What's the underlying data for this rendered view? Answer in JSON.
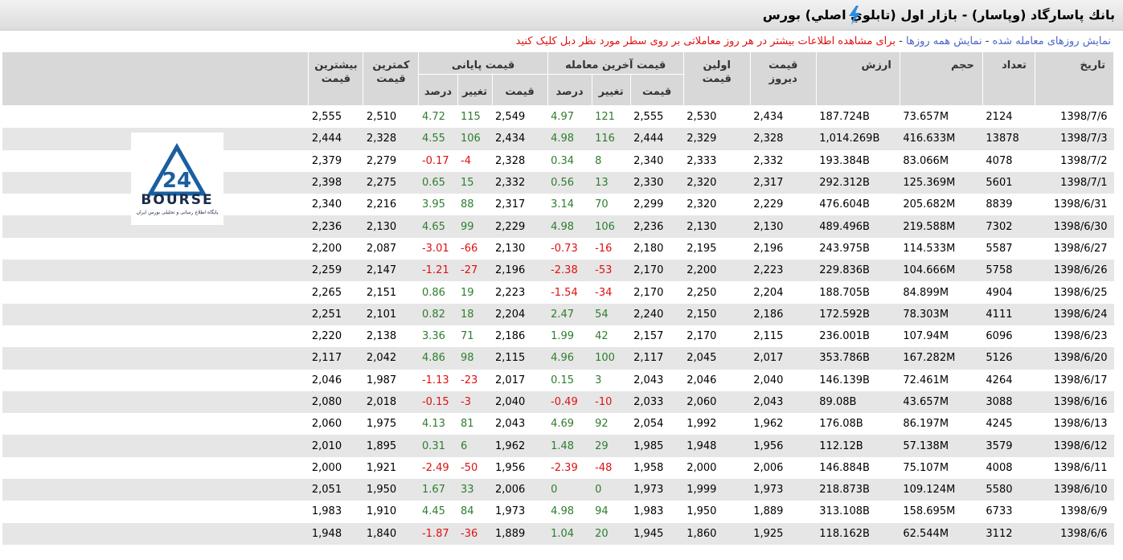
{
  "title": "بانك پاسارگاد (وپاسار) - بازار اول (تابلوي اصلي) بورس",
  "links": {
    "traded_days": "نمایش روزهای معامله شده",
    "all_days": "نمایش همه روزها",
    "separator": " - ",
    "hint": "برای مشاهده اطلاعات بیشتر در هر روز معاملاتی بر روی سطر مورد نظر دبل کلیک کنید"
  },
  "headers": {
    "date": "تاریخ",
    "count": "تعداد",
    "volume": "حجم",
    "value": "ارزش",
    "yesterday": "قیمت دیروز",
    "first": "اولین قیمت",
    "last_group": "قیمت آخرین معامله",
    "close_group": "قیمت پایانی",
    "price": "قیمت",
    "change": "تغییر",
    "percent": "درصد",
    "min": "کمترین قیمت",
    "max": "بیشترین قیمت"
  },
  "logo": {
    "word": "BOURSE",
    "number": "24",
    "tagline": "پایگاه اطلاع رسانی و تحلیلی بورس ایران"
  },
  "colors": {
    "positive": "#2e7d2e",
    "negative": "#e01010",
    "link": "#4a64c8",
    "header_bg": "#d8d8d8",
    "stripe": "#e6e6e6"
  },
  "rows": [
    {
      "date": "1398/7/6",
      "count": "2124",
      "volume": "73.657M",
      "value": "187.724B",
      "yesterday": "2,434",
      "first": "2,530",
      "last_price": "2,555",
      "last_change": "121",
      "last_percent": "4.97",
      "close_price": "2,549",
      "close_change": "115",
      "close_percent": "4.72",
      "min": "2,510",
      "max": "2,555"
    },
    {
      "date": "1398/7/3",
      "count": "13878",
      "volume": "416.633M",
      "value": "1,014.269B",
      "yesterday": "2,328",
      "first": "2,329",
      "last_price": "2,444",
      "last_change": "116",
      "last_percent": "4.98",
      "close_price": "2,434",
      "close_change": "106",
      "close_percent": "4.55",
      "min": "2,328",
      "max": "2,444"
    },
    {
      "date": "1398/7/2",
      "count": "4078",
      "volume": "83.066M",
      "value": "193.384B",
      "yesterday": "2,332",
      "first": "2,333",
      "last_price": "2,340",
      "last_change": "8",
      "last_percent": "0.34",
      "close_price": "2,328",
      "close_change": "-4",
      "close_percent": "-0.17",
      "min": "2,279",
      "max": "2,379"
    },
    {
      "date": "1398/7/1",
      "count": "5601",
      "volume": "125.369M",
      "value": "292.312B",
      "yesterday": "2,317",
      "first": "2,320",
      "last_price": "2,330",
      "last_change": "13",
      "last_percent": "0.56",
      "close_price": "2,332",
      "close_change": "15",
      "close_percent": "0.65",
      "min": "2,275",
      "max": "2,398"
    },
    {
      "date": "1398/6/31",
      "count": "8839",
      "volume": "205.682M",
      "value": "476.604B",
      "yesterday": "2,229",
      "first": "2,320",
      "last_price": "2,299",
      "last_change": "70",
      "last_percent": "3.14",
      "close_price": "2,317",
      "close_change": "88",
      "close_percent": "3.95",
      "min": "2,216",
      "max": "2,340"
    },
    {
      "date": "1398/6/30",
      "count": "7302",
      "volume": "219.588M",
      "value": "489.496B",
      "yesterday": "2,130",
      "first": "2,130",
      "last_price": "2,236",
      "last_change": "106",
      "last_percent": "4.98",
      "close_price": "2,229",
      "close_change": "99",
      "close_percent": "4.65",
      "min": "2,130",
      "max": "2,236"
    },
    {
      "date": "1398/6/27",
      "count": "5587",
      "volume": "114.533M",
      "value": "243.975B",
      "yesterday": "2,196",
      "first": "2,195",
      "last_price": "2,180",
      "last_change": "-16",
      "last_percent": "-0.73",
      "close_price": "2,130",
      "close_change": "-66",
      "close_percent": "-3.01",
      "min": "2,087",
      "max": "2,200"
    },
    {
      "date": "1398/6/26",
      "count": "5758",
      "volume": "104.666M",
      "value": "229.836B",
      "yesterday": "2,223",
      "first": "2,200",
      "last_price": "2,170",
      "last_change": "-53",
      "last_percent": "-2.38",
      "close_price": "2,196",
      "close_change": "-27",
      "close_percent": "-1.21",
      "min": "2,147",
      "max": "2,259"
    },
    {
      "date": "1398/6/25",
      "count": "4904",
      "volume": "84.899M",
      "value": "188.705B",
      "yesterday": "2,204",
      "first": "2,250",
      "last_price": "2,170",
      "last_change": "-34",
      "last_percent": "-1.54",
      "close_price": "2,223",
      "close_change": "19",
      "close_percent": "0.86",
      "min": "2,151",
      "max": "2,265"
    },
    {
      "date": "1398/6/24",
      "count": "4111",
      "volume": "78.303M",
      "value": "172.592B",
      "yesterday": "2,186",
      "first": "2,150",
      "last_price": "2,240",
      "last_change": "54",
      "last_percent": "2.47",
      "close_price": "2,204",
      "close_change": "18",
      "close_percent": "0.82",
      "min": "2,101",
      "max": "2,251"
    },
    {
      "date": "1398/6/23",
      "count": "6096",
      "volume": "107.94M",
      "value": "236.001B",
      "yesterday": "2,115",
      "first": "2,170",
      "last_price": "2,157",
      "last_change": "42",
      "last_percent": "1.99",
      "close_price": "2,186",
      "close_change": "71",
      "close_percent": "3.36",
      "min": "2,138",
      "max": "2,220"
    },
    {
      "date": "1398/6/20",
      "count": "5126",
      "volume": "167.282M",
      "value": "353.786B",
      "yesterday": "2,017",
      "first": "2,045",
      "last_price": "2,117",
      "last_change": "100",
      "last_percent": "4.96",
      "close_price": "2,115",
      "close_change": "98",
      "close_percent": "4.86",
      "min": "2,042",
      "max": "2,117"
    },
    {
      "date": "1398/6/17",
      "count": "4264",
      "volume": "72.461M",
      "value": "146.139B",
      "yesterday": "2,040",
      "first": "2,046",
      "last_price": "2,043",
      "last_change": "3",
      "last_percent": "0.15",
      "close_price": "2,017",
      "close_change": "-23",
      "close_percent": "-1.13",
      "min": "1,987",
      "max": "2,046"
    },
    {
      "date": "1398/6/16",
      "count": "3088",
      "volume": "43.657M",
      "value": "89.08B",
      "yesterday": "2,043",
      "first": "2,060",
      "last_price": "2,033",
      "last_change": "-10",
      "last_percent": "-0.49",
      "close_price": "2,040",
      "close_change": "-3",
      "close_percent": "-0.15",
      "min": "2,018",
      "max": "2,080"
    },
    {
      "date": "1398/6/13",
      "count": "4245",
      "volume": "86.197M",
      "value": "176.08B",
      "yesterday": "1,962",
      "first": "1,992",
      "last_price": "2,054",
      "last_change": "92",
      "last_percent": "4.69",
      "close_price": "2,043",
      "close_change": "81",
      "close_percent": "4.13",
      "min": "1,975",
      "max": "2,060"
    },
    {
      "date": "1398/6/12",
      "count": "3579",
      "volume": "57.138M",
      "value": "112.12B",
      "yesterday": "1,956",
      "first": "1,948",
      "last_price": "1,985",
      "last_change": "29",
      "last_percent": "1.48",
      "close_price": "1,962",
      "close_change": "6",
      "close_percent": "0.31",
      "min": "1,895",
      "max": "2,010"
    },
    {
      "date": "1398/6/11",
      "count": "4008",
      "volume": "75.107M",
      "value": "146.884B",
      "yesterday": "2,006",
      "first": "2,000",
      "last_price": "1,958",
      "last_change": "-48",
      "last_percent": "-2.39",
      "close_price": "1,956",
      "close_change": "-50",
      "close_percent": "-2.49",
      "min": "1,921",
      "max": "2,000"
    },
    {
      "date": "1398/6/10",
      "count": "5580",
      "volume": "109.124M",
      "value": "218.873B",
      "yesterday": "1,973",
      "first": "1,999",
      "last_price": "1,973",
      "last_change": "0",
      "last_percent": "0",
      "close_price": "2,006",
      "close_change": "33",
      "close_percent": "1.67",
      "min": "1,950",
      "max": "2,051"
    },
    {
      "date": "1398/6/9",
      "count": "6733",
      "volume": "158.695M",
      "value": "313.108B",
      "yesterday": "1,889",
      "first": "1,950",
      "last_price": "1,983",
      "last_change": "94",
      "last_percent": "4.98",
      "close_price": "1,973",
      "close_change": "84",
      "close_percent": "4.45",
      "min": "1,910",
      "max": "1,983"
    },
    {
      "date": "1398/6/6",
      "count": "3112",
      "volume": "62.544M",
      "value": "118.162B",
      "yesterday": "1,925",
      "first": "1,860",
      "last_price": "1,945",
      "last_change": "20",
      "last_percent": "1.04",
      "close_price": "1,889",
      "close_change": "-36",
      "close_percent": "-1.87",
      "min": "1,840",
      "max": "1,948"
    }
  ]
}
